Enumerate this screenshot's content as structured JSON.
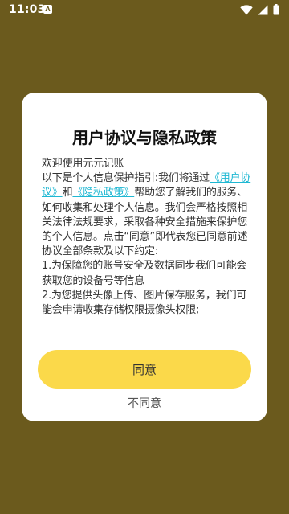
{
  "status_bar": {
    "time": "11:03",
    "app_icon_letter": "A"
  },
  "dialog": {
    "title": "用户协议与隐私政策",
    "body": {
      "welcome": "欢迎使用元元记账",
      "intro_prefix": "以下是个人信息保护指引:我们将通过",
      "user_agreement_link": "《用户协议》",
      "and_text": "和",
      "privacy_policy_link": "《隐私政策》",
      "intro_suffix": "帮助您了解我们的服务、如何收集和处理个人信息。我们会严格按照相关法律法规要求，采取各种安全措施来保护您的个人信息。点击“同意”即代表您已同意前述协议全部条款及以下约定:",
      "item_1": "1.为保障您的账号安全及数据同步我们可能会获取您的设备号等信息",
      "item_2": "2.为您提供头像上传、图片保存服务，我们可能会申请收集存储权限摄像头权限;"
    },
    "agree_label": "同意",
    "disagree_label": "不同意"
  },
  "colors": {
    "backdrop": "#6b5a1d",
    "accent": "#fbd94a",
    "link": "#1fb8d3"
  }
}
